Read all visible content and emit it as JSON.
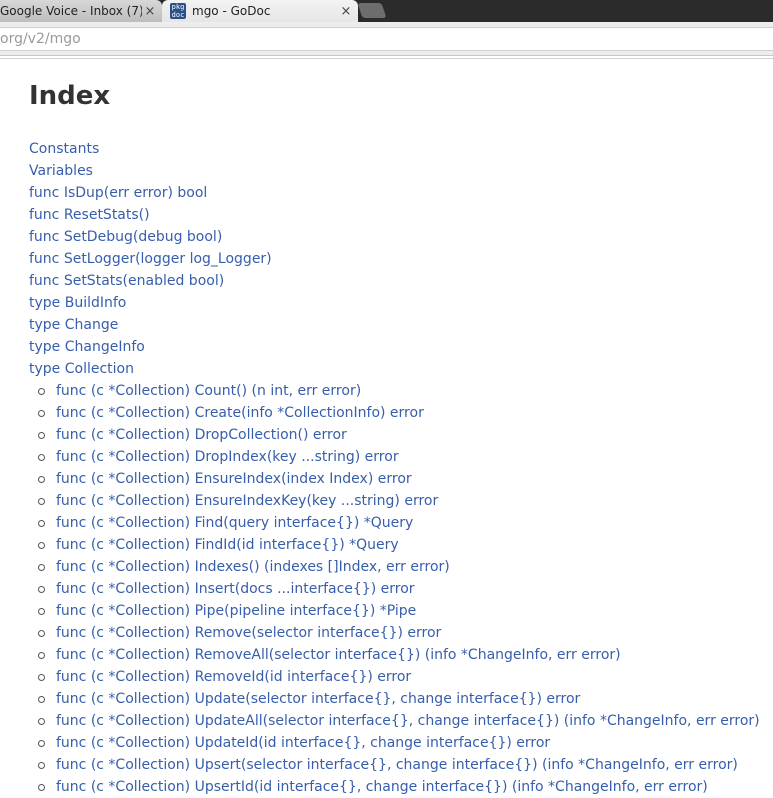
{
  "browser": {
    "tabs": [
      {
        "label": "Google Voice - Inbox (7)",
        "close": "×"
      },
      {
        "label": "mgo - GoDoc",
        "close": "×",
        "favicon_lines": [
          "pkg",
          "doc"
        ]
      }
    ],
    "url": "org/v2/mgo"
  },
  "page": {
    "title": "Index",
    "index_items": [
      "Constants",
      "Variables",
      "func IsDup(err error) bool",
      "func ResetStats()",
      "func SetDebug(debug bool)",
      "func SetLogger(logger log_Logger)",
      "func SetStats(enabled bool)",
      "type BuildInfo",
      "type Change",
      "type ChangeInfo",
      "type Collection"
    ],
    "collection_methods": [
      "func (c *Collection) Count() (n int, err error)",
      "func (c *Collection) Create(info *CollectionInfo) error",
      "func (c *Collection) DropCollection() error",
      "func (c *Collection) DropIndex(key ...string) error",
      "func (c *Collection) EnsureIndex(index Index) error",
      "func (c *Collection) EnsureIndexKey(key ...string) error",
      "func (c *Collection) Find(query interface{}) *Query",
      "func (c *Collection) FindId(id interface{}) *Query",
      "func (c *Collection) Indexes() (indexes []Index, err error)",
      "func (c *Collection) Insert(docs ...interface{}) error",
      "func (c *Collection) Pipe(pipeline interface{}) *Pipe",
      "func (c *Collection) Remove(selector interface{}) error",
      "func (c *Collection) RemoveAll(selector interface{}) (info *ChangeInfo, err error)",
      "func (c *Collection) RemoveId(id interface{}) error",
      "func (c *Collection) Update(selector interface{}, change interface{}) error",
      "func (c *Collection) UpdateAll(selector interface{}, change interface{}) (info *ChangeInfo, err error)",
      "func (c *Collection) UpdateId(id interface{}, change interface{}) error",
      "func (c *Collection) Upsert(selector interface{}, change interface{}) (info *ChangeInfo, err error)",
      "func (c *Collection) UpsertId(id interface{}, change interface{}) (info *ChangeInfo, err error)"
    ]
  },
  "colors": {
    "link": "#375eab",
    "heading": "#333333"
  }
}
